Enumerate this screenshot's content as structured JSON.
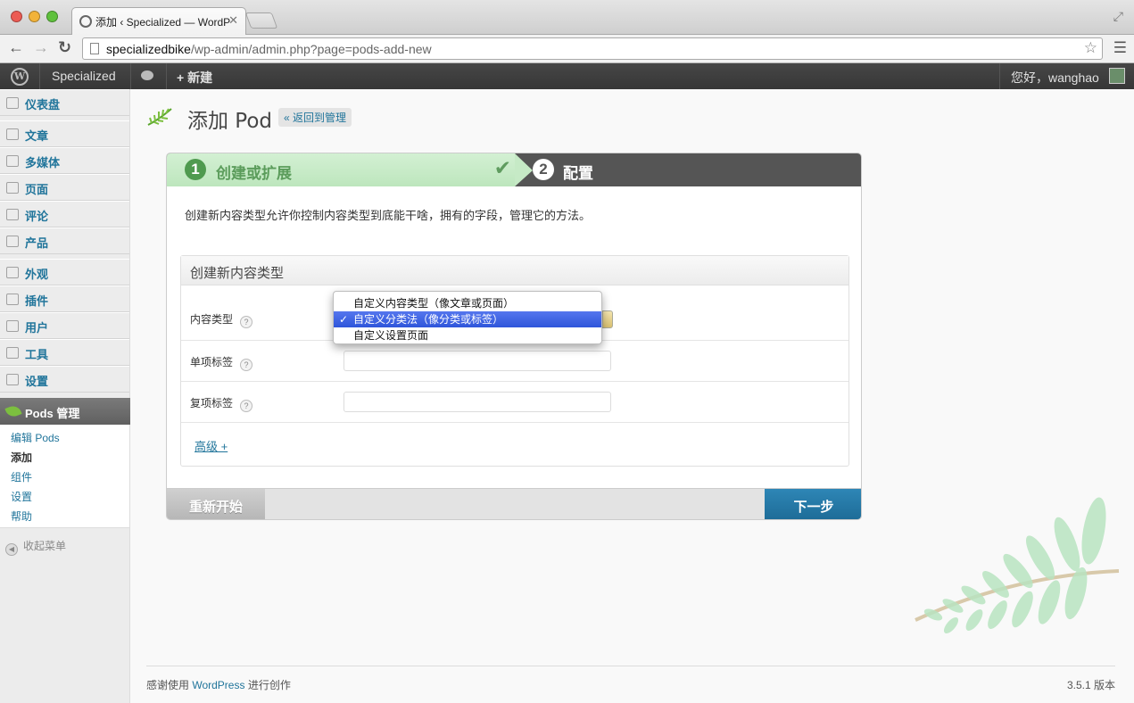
{
  "browser": {
    "tab_title": "添加 ‹ Specialized — WordP",
    "tab_close": "✕",
    "url_host": "specializedbike",
    "url_path": "/wp-admin/admin.php?page=pods-add-new"
  },
  "adminbar": {
    "site_name": "Specialized",
    "new_label": "新建",
    "greeting": "您好，wanghao"
  },
  "sidebar": {
    "items": [
      {
        "label": "仪表盘"
      },
      {
        "label": "文章"
      },
      {
        "label": "多媒体"
      },
      {
        "label": "页面"
      },
      {
        "label": "评论"
      },
      {
        "label": "产品"
      },
      {
        "label": "外观"
      },
      {
        "label": "插件"
      },
      {
        "label": "用户"
      },
      {
        "label": "工具"
      },
      {
        "label": "设置"
      }
    ],
    "active": "Pods 管理",
    "submenu": [
      "编辑 Pods",
      "添加",
      "组件",
      "设置",
      "帮助"
    ],
    "collapse": "收起菜单"
  },
  "page": {
    "title": "添加 Pod",
    "back_link": "« 返回到管理"
  },
  "wizard": {
    "step1_num": "1",
    "step1_label": "创建或扩展",
    "step1_check": "✔",
    "step2_num": "2",
    "step2_label": "配置",
    "intro": "创建新内容类型允许你控制内容类型到底能干啥，拥有的字段，管理它的方法。",
    "panel_title": "创建新内容类型",
    "fields": {
      "type_label": "内容类型",
      "singular_label": "单项标签",
      "plural_label": "复项标签"
    },
    "help_glyph": "?",
    "advanced": "高级 +",
    "restart": "重新开始",
    "next": "下一步"
  },
  "dropdown": {
    "options": [
      "自定义内容类型（像文章或页面）",
      "自定义分类法（像分类或标签）",
      "自定义设置页面"
    ],
    "selected": "自定义分类法（像分类或标签）",
    "tick": "✓"
  },
  "footer": {
    "thanks_prefix": "感谢使用 ",
    "wordpress": "WordPress",
    "thanks_suffix": " 进行创作",
    "version": "3.5.1 版本"
  },
  "colors": {
    "admin_link": "#21759b",
    "step_done": "#bde6bd",
    "next_button": "#1d6b96",
    "dropdown_selected": "#2f55da"
  }
}
